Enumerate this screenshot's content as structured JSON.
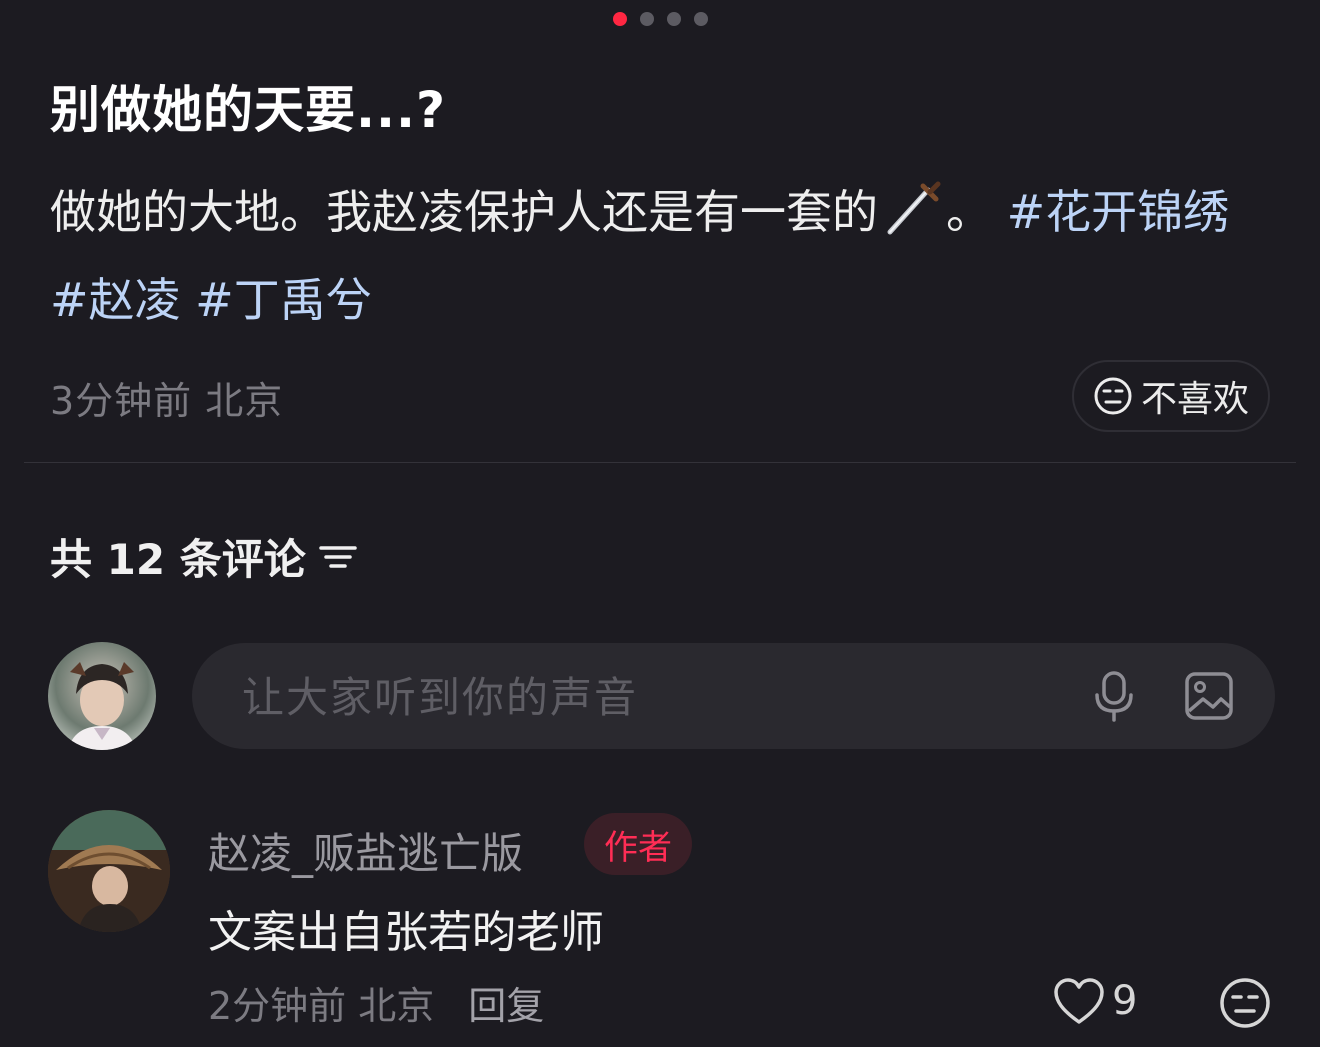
{
  "carousel": {
    "total": 4,
    "active_index": 0,
    "active_color": "#ff2742",
    "inactive_color": "#5c5b62"
  },
  "post": {
    "title": "别做她的天要...?",
    "body_text_1": "做她的大地。我赵凌保护人还是有一套的",
    "sword_emoji": "sword-icon",
    "body_text_2": "。",
    "tags": [
      "#花开锦绣",
      "#赵凌",
      "#丁禹兮"
    ],
    "meta": "3分钟前 北京",
    "dislike_label": "不喜欢"
  },
  "comments": {
    "header": "共 12 条评论",
    "sort_icon": "filter-lines-icon",
    "input_placeholder": "让大家听到你的声音",
    "items": [
      {
        "username": "赵凌_贩盐逃亡版",
        "badge": "作者",
        "text": "文案出自张若昀老师",
        "time_location": "2分钟前 北京",
        "reply_label": "回复",
        "like_count": "9"
      }
    ]
  },
  "colors": {
    "background": "#1c1b21",
    "tag": "#bcd3f6",
    "badge_text": "#ff2d55",
    "badge_bg": "#3a1f27"
  }
}
